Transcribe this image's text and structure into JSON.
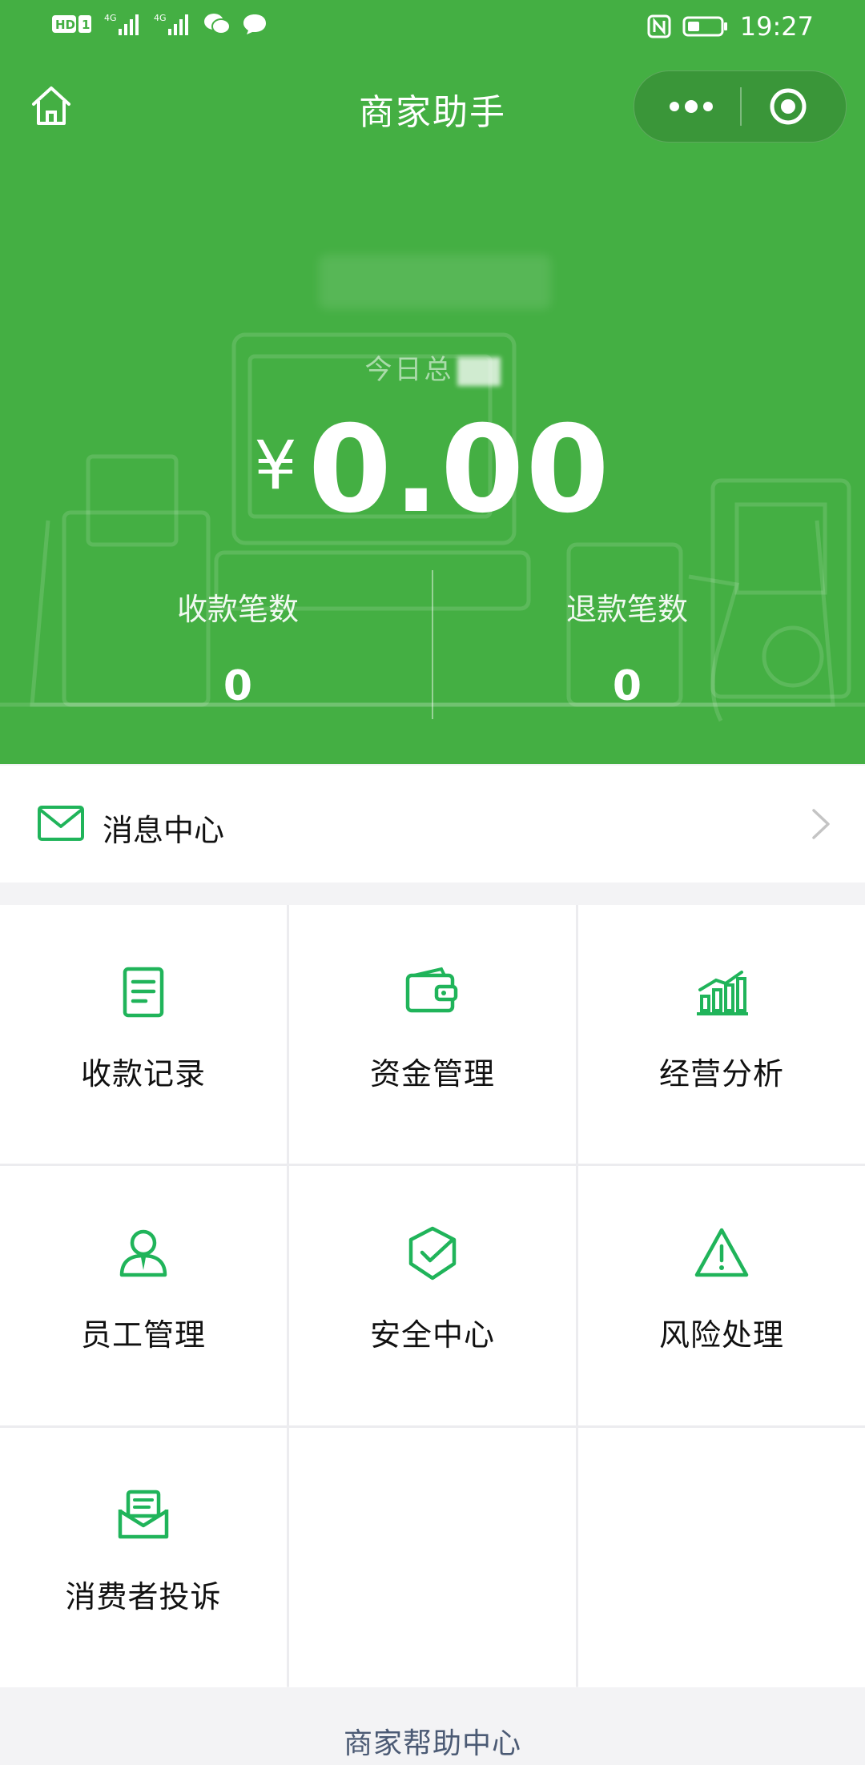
{
  "status_bar": {
    "left_icons": [
      "hd-icon",
      "sim1-icon",
      "signal-4g-icon",
      "signal-4g-icon",
      "wechat-icon",
      "message-icon"
    ],
    "right_icons": [
      "nfc-icon",
      "battery-icon"
    ],
    "time": "19:27"
  },
  "nav": {
    "title": "商家助手"
  },
  "summary": {
    "today_label": "今日总",
    "currency": "¥",
    "amount": "0.00",
    "stats": [
      {
        "label": "收款笔数",
        "value": "0"
      },
      {
        "label": "退款笔数",
        "value": "0"
      }
    ]
  },
  "message_center": {
    "label": "消息中心"
  },
  "grid": [
    {
      "label": "收款记录",
      "icon": "receipt-icon"
    },
    {
      "label": "资金管理",
      "icon": "wallet-icon"
    },
    {
      "label": "经营分析",
      "icon": "bar-chart-icon"
    },
    {
      "label": "员工管理",
      "icon": "employee-icon"
    },
    {
      "label": "安全中心",
      "icon": "shield-icon"
    },
    {
      "label": "风险处理",
      "icon": "warning-icon"
    },
    {
      "label": "消费者投诉",
      "icon": "complaint-mail-icon"
    }
  ],
  "footer": {
    "help_center": "商家帮助中心"
  },
  "colors": {
    "brand_green": "#44af43",
    "icon_green": "#20b45a"
  }
}
